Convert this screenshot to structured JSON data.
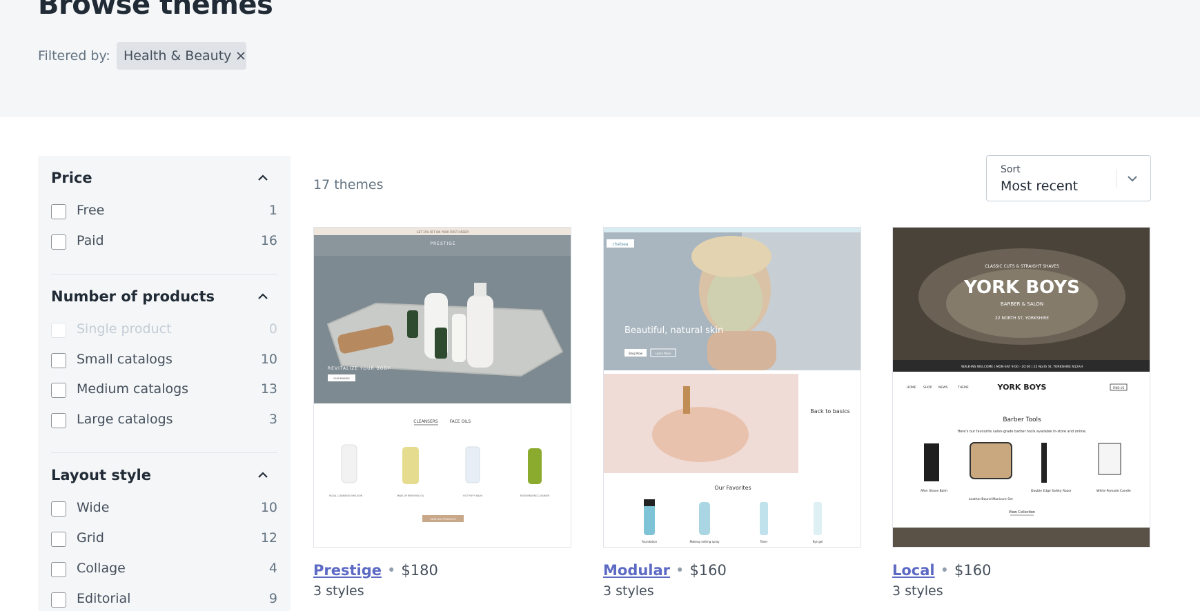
{
  "header": {
    "title": "Browse themes",
    "filtered_by_label": "Filtered by:",
    "active_filter": "Health & Beauty"
  },
  "sidebar": {
    "sections": [
      {
        "title": "Price",
        "options": [
          {
            "label": "Free",
            "count": "1"
          },
          {
            "label": "Paid",
            "count": "16"
          }
        ]
      },
      {
        "title": "Number of products",
        "options": [
          {
            "label": "Single product",
            "count": "0",
            "disabled": true
          },
          {
            "label": "Small catalogs",
            "count": "10"
          },
          {
            "label": "Medium catalogs",
            "count": "13"
          },
          {
            "label": "Large catalogs",
            "count": "3"
          }
        ]
      },
      {
        "title": "Layout style",
        "options": [
          {
            "label": "Wide",
            "count": "10"
          },
          {
            "label": "Grid",
            "count": "12"
          },
          {
            "label": "Collage",
            "count": "4"
          },
          {
            "label": "Editorial",
            "count": "9"
          }
        ]
      }
    ]
  },
  "results": {
    "count_text": "17 themes",
    "sort": {
      "label": "Sort",
      "value": "Most recent"
    }
  },
  "themes": [
    {
      "name": "Prestige",
      "price": "$180",
      "styles": "3 styles",
      "preview": {
        "announcement": "GET 15% OFF ON YOUR FIRST ORDER!",
        "brand": "PRESTIGE",
        "hero_heading": "REVITALIZE YOUR BODY",
        "hero_button": "OUR BRANDS",
        "tabs": [
          "CLEANSERS",
          "FACE OILS"
        ],
        "products": [
          "FACIAL CLEANSING EMULSION",
          "MAKE-UP REMOVING OIL",
          "HOT PUFFY BALM",
          "REGENERATING CLEANSER"
        ],
        "view_all": "VIEW ALL PRODUCTS"
      }
    },
    {
      "name": "Modular",
      "price": "$160",
      "styles": "3 styles",
      "preview": {
        "brand": "chelsea",
        "hero_heading": "Beautiful, natural skin",
        "buttons": [
          "Shop Now",
          "Learn More"
        ],
        "side_heading": "Back to basics",
        "favorites_title": "Our Favorites",
        "products": [
          "Foundation",
          "Makeup setting spray",
          "Toner",
          "Eye gel"
        ]
      }
    },
    {
      "name": "Local",
      "price": "$160",
      "styles": "3 styles",
      "preview": {
        "logo": "YORK BOYS",
        "logo_top": "CLASSIC CUTS & STRAIGHT SHAVES",
        "logo_mid": "BARBER & SALON",
        "logo_bottom": "22 NORTH ST, YORKSHIRE",
        "banner": "WALK-INS WELCOME | MON-SAT 9:00 - 20:00 | 22 North St, YORKSHIRE N12AH",
        "nav": [
          "HOME",
          "SHOP",
          "NEWS",
          "THEME"
        ],
        "find_us": "FIND US",
        "section_title": "Barber Tools",
        "section_subtitle": "Here's our favourite salon-grade barber tools available in-store and online.",
        "products": [
          "After Shave Balm",
          "Leather-Bound Manicure Set",
          "Double Edge Safety Razor",
          "White Pomade Candle"
        ],
        "view_collection": "View Collection"
      }
    }
  ]
}
